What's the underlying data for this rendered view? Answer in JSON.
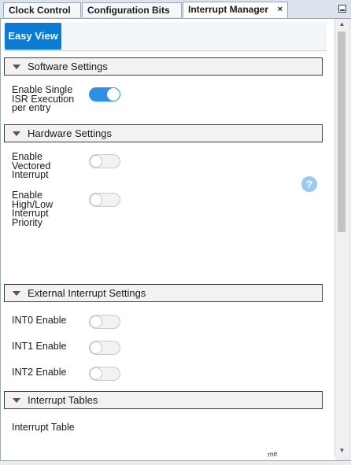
{
  "tabs": [
    {
      "label": "Clock Control"
    },
    {
      "label": "Configuration Bits"
    },
    {
      "label": "Interrupt Manager",
      "close": "×"
    }
  ],
  "subtab": {
    "label": "Easy View"
  },
  "sections": {
    "software": {
      "title": "Software Settings",
      "rows": [
        {
          "label": "Enable Single ISR Execution per entry",
          "state": "on"
        }
      ]
    },
    "hardware": {
      "title": "Hardware Settings",
      "rows": [
        {
          "label": "Enable Vectored Interrupt",
          "state": "off"
        },
        {
          "label": "Enable High/Low Interrupt Priority",
          "state": "off"
        }
      ],
      "help": "?"
    },
    "external": {
      "title": "External Interrupt Settings",
      "rows": [
        {
          "label": "INT0 Enable",
          "state": "off"
        },
        {
          "label": "INT1 Enable",
          "state": "off"
        },
        {
          "label": "INT2 Enable",
          "state": "off"
        }
      ]
    },
    "tables": {
      "title": "Interrupt Tables",
      "item": "Interrupt Table"
    }
  },
  "scroll": {
    "up": "▲",
    "down": "▼"
  },
  "colors": {
    "accent": "#0b7bd3",
    "toggle_on": "#2f8fe8",
    "help_icon": "#9dc9ee"
  },
  "clipped_text": "me"
}
